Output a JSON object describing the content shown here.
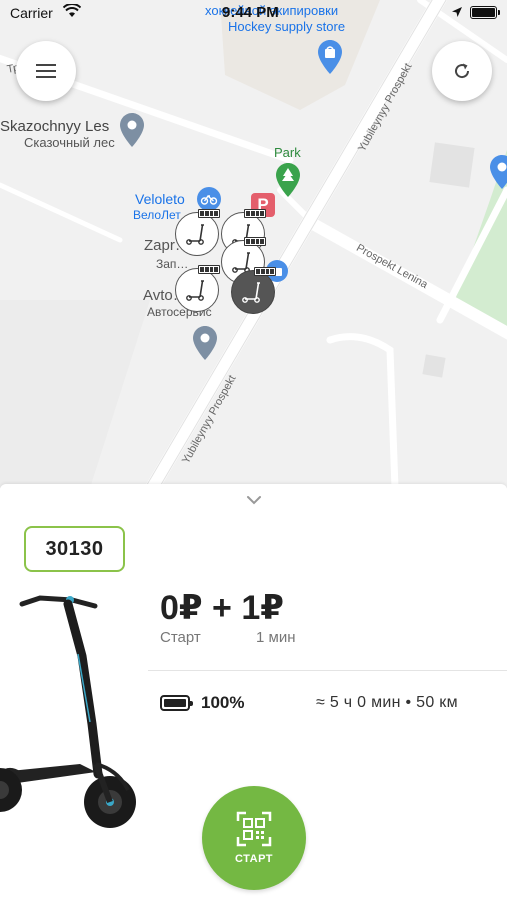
{
  "status_bar": {
    "carrier": "Carrier",
    "time": "9:44 PM"
  },
  "map": {
    "labels": {
      "hockey_ru": "хоккейной экипировки",
      "hockey_en": "Hockey supply store",
      "street_top": "Тр…вья ул.",
      "skazochnyy_en": "Skazochnyy Les",
      "skazochnyy_ru": "Сказочный лес",
      "park": "Park",
      "veloleto_en": "Veloleto",
      "veloleto_ru": "ВелоЛет…",
      "zapr_en": "Zapr…",
      "zapr_ru": "Зап…",
      "avto_en": "Avto…s",
      "avto_ru": "Автосервис",
      "yubileyny_top": "Yubileynyy Prospekt",
      "yubileyny_bottom": "Yubileynyy Prospekt",
      "lenina": "Prospekt Lenina"
    },
    "parking_letter": "P",
    "colors": {
      "blue_poi": "#4a8fe7",
      "green_park": "#3aa34c",
      "grey_poi": "#7d8fa3",
      "park_area": "#d3ecd0"
    }
  },
  "buttons": {
    "menu_icon": "hamburger-icon",
    "refresh_icon": "refresh-icon"
  },
  "scooter": {
    "id": "30130",
    "price": "0₽ + 1₽",
    "start_caption": "Старт",
    "per_minute_caption": "1 мин",
    "battery_percent": "100%",
    "range": "≈ 5 ч 0 мин • 50 км",
    "start_button_label": "СТАРТ",
    "accent_color": "#74b843"
  }
}
